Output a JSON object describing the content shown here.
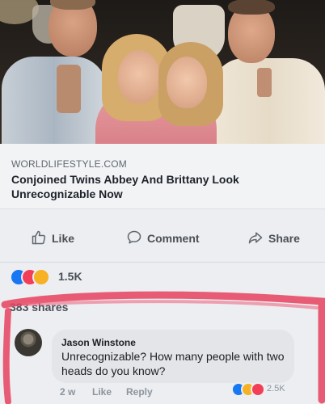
{
  "link_preview": {
    "domain": "WORLDLIFESTYLE.COM",
    "headline": "Conjoined Twins Abbey And Brittany Look Unrecognizable Now"
  },
  "actions": {
    "like": "Like",
    "comment": "Comment",
    "share": "Share"
  },
  "reactions": {
    "icons": [
      "love-icon",
      "like-icon",
      "wow-icon"
    ],
    "count": "1.5K"
  },
  "shares": "383 shares",
  "comment": {
    "author": "Jason Winstone",
    "text": "Unrecognizable? How many people with two heads do you know?",
    "time": "2 w",
    "like": "Like",
    "reply": "Reply",
    "reaction_count": "2.5K",
    "reaction_icons": [
      "like-icon",
      "haha-icon",
      "love-icon"
    ]
  },
  "colors": {
    "like_blue": "#1877f2",
    "love_red": "#f33e58",
    "wow_yellow": "#f7b125",
    "highlight_red": "#e8415f"
  }
}
